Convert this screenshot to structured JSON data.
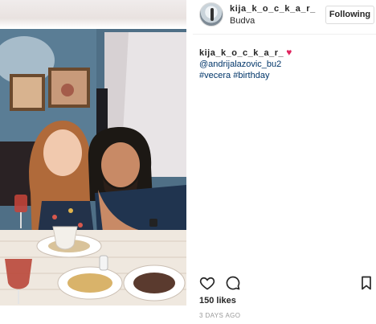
{
  "header": {
    "username": "kija_k_o_c_k_a_r_",
    "location": "Budva",
    "follow_label": "Following",
    "avatar_icon": "lighthouse-avatar"
  },
  "caption": {
    "username": "kija_k_o_c_k_a_r_",
    "heart": "♥",
    "mention": "@andrijalazovic_bu2",
    "hashtag_1": "#vecera",
    "hashtag_2": "#birthday"
  },
  "actions": {
    "like_icon": "heart-outline-icon",
    "comment_icon": "comment-bubble-icon",
    "save_icon": "bookmark-icon"
  },
  "likes_text": "150 likes",
  "timestamp": "3 DAYS AGO",
  "colors": {
    "link": "#003569",
    "heart": "#e0245e",
    "border": "#dbdbdb"
  }
}
